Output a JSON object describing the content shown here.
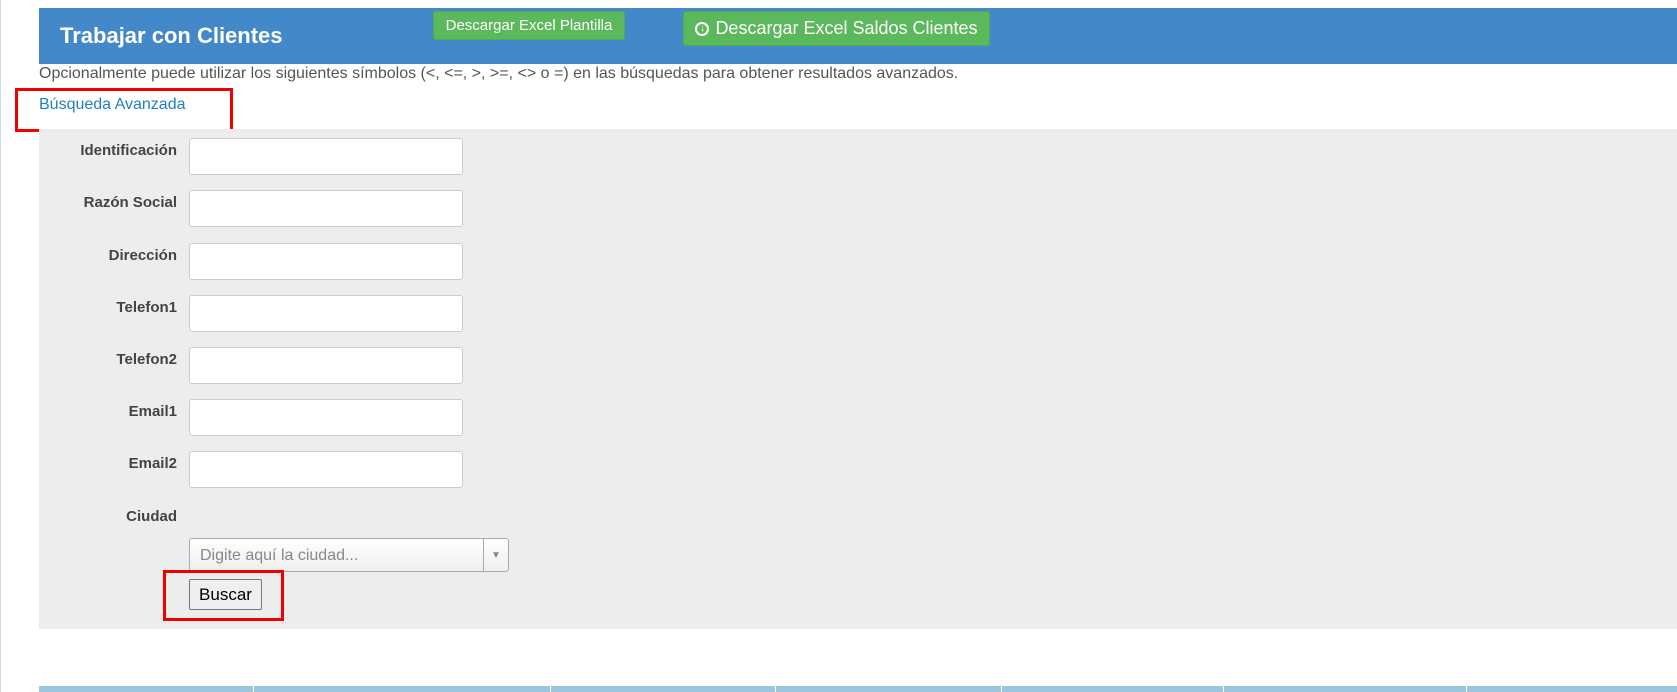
{
  "header": {
    "title": "Trabajar con Clientes",
    "btn_plantilla": "Descargar Excel Plantilla",
    "btn_saldos": "Descargar Excel Saldos Clientes",
    "btn_saldos_icon": "download-circle-icon",
    "accent_color": "#4389c9",
    "button_color": "#5cb85c"
  },
  "hint": "Opcionalmente puede utilizar los siguientes símbolos (<, <=, >, >=, <> o =) en las búsquedas para obtener resultados avanzados.",
  "advanced_link": "Búsqueda Avanzada",
  "form": {
    "fields": [
      {
        "label": "Identificación",
        "value": ""
      },
      {
        "label": "Razón Social",
        "value": ""
      },
      {
        "label": "Dirección",
        "value": ""
      },
      {
        "label": "Telefon1",
        "value": ""
      },
      {
        "label": "Telefon2",
        "value": ""
      },
      {
        "label": "Email1",
        "value": ""
      },
      {
        "label": "Email2",
        "value": ""
      }
    ],
    "city_label": "Ciudad",
    "city_placeholder": "Digite aquí la ciudad...",
    "search_button": "Buscar"
  },
  "highlight_color": "#f20000"
}
